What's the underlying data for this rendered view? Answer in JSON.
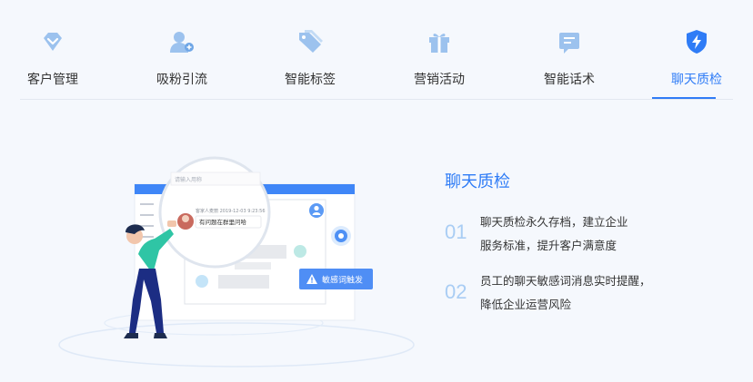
{
  "tabs": [
    {
      "label": "客户管理",
      "icon": "diamond-icon",
      "active": false
    },
    {
      "label": "吸粉引流",
      "icon": "add-user-icon",
      "active": false
    },
    {
      "label": "智能标签",
      "icon": "tags-icon",
      "active": false
    },
    {
      "label": "营销活动",
      "icon": "gift-icon",
      "active": false
    },
    {
      "label": "智能话术",
      "icon": "chat-script-icon",
      "active": false
    },
    {
      "label": "聊天质检",
      "icon": "shield-bolt-icon",
      "active": true
    }
  ],
  "colors": {
    "accent": "#2f7cf6",
    "icon": "#9cc2ee",
    "number": "#a9cdf4"
  },
  "illustration": {
    "search_placeholder": "请输入用称",
    "message_meta": "客家人麦丽  2019-12-03 9:23:56",
    "message_text": "有问题在群里问哈",
    "alert_text": "敏感词触发"
  },
  "content": {
    "title": "聊天质检",
    "features": [
      {
        "num": "01",
        "line1": "聊天质检永久存档，建立企业",
        "line2": "服务标准，提升客户满意度"
      },
      {
        "num": "02",
        "line1": "员工的聊天敏感词消息实时提醒，",
        "line2": "降低企业运营风险"
      }
    ]
  }
}
